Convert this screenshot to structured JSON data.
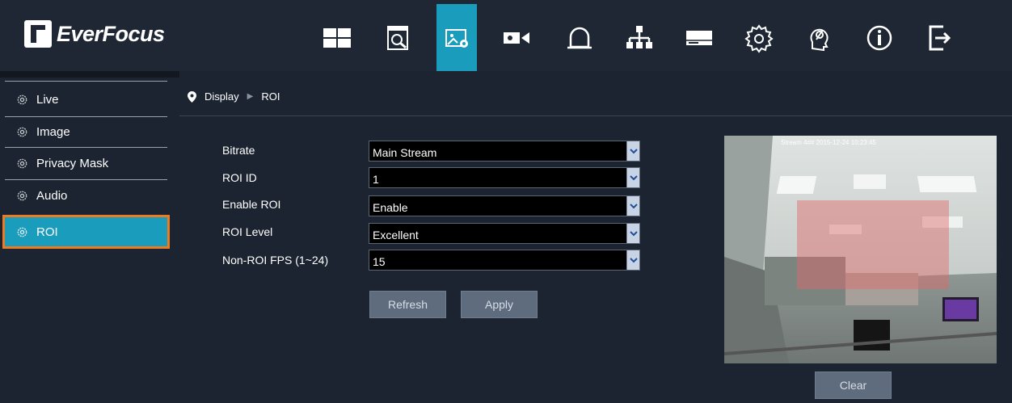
{
  "brand": {
    "name": "EverFocus"
  },
  "nav": {
    "icons": [
      "layout-icon",
      "playback-search-icon",
      "display-settings-icon",
      "camera-icon",
      "alarm-icon",
      "network-icon",
      "storage-icon",
      "settings-icon",
      "maintenance-icon",
      "info-icon",
      "logout-icon"
    ],
    "active": "display-settings-icon"
  },
  "sidebar": {
    "items": [
      {
        "label": "Live"
      },
      {
        "label": "Image"
      },
      {
        "label": "Privacy Mask"
      },
      {
        "label": "Audio"
      },
      {
        "label": "ROI"
      }
    ],
    "active_index": 4
  },
  "breadcrumb": {
    "parent": "Display",
    "current": "ROI"
  },
  "form": {
    "fields": [
      {
        "label": "Bitrate",
        "value": "Main Stream"
      },
      {
        "label": "ROI ID",
        "value": "1"
      },
      {
        "label": "Enable ROI",
        "value": "Enable"
      },
      {
        "label": "ROI Level",
        "value": "Excellent"
      },
      {
        "label": "Non-ROI FPS (1~24)",
        "value": "15"
      }
    ],
    "refresh_label": "Refresh",
    "apply_label": "Apply"
  },
  "preview": {
    "overlay_text": "Stream 4##   2015-12-24 10:23:45",
    "clear_label": "Clear"
  },
  "colors": {
    "accent": "#1a9dbd",
    "highlight": "#ee7b22",
    "background": "#1b2430"
  }
}
